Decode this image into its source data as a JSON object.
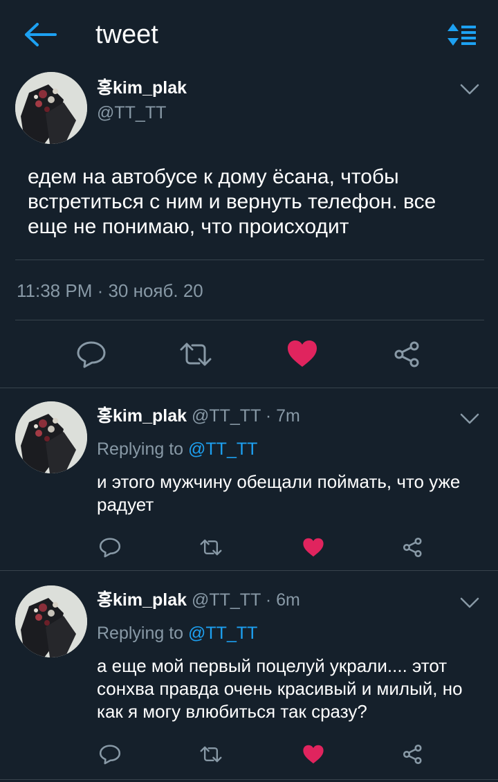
{
  "header": {
    "title": "tweet",
    "back_icon": "arrow-left-icon",
    "sort_icon": "sort-lines-icon"
  },
  "colors": {
    "background": "#15202b",
    "accent": "#1da1f2",
    "secondary_text": "#8899a6",
    "like": "#e0245e",
    "divider": "#38444d"
  },
  "main_tweet": {
    "display_name": "홍kim_plak",
    "handle": "@TT_TT",
    "text": "едем на автобусе к дому ёсана, чтобы встретиться с ним и вернуть телефон. все еще не понимаю, что происходит",
    "timestamp": "11:38 PM · 30 нояб. 20",
    "liked": true
  },
  "replies": [
    {
      "display_name": "홍kim_plak",
      "handle_time": "@TT_TT · 7m",
      "replying_prefix": "Replying to",
      "replying_mention": "@TT_TT",
      "text": "и этого мужчину обещали поймать, что уже радует",
      "liked": true
    },
    {
      "display_name": "홍kim_plak",
      "handle_time": "@TT_TT · 6m",
      "replying_prefix": "Replying to",
      "replying_mention": "@TT_TT",
      "text": "а еще мой первый поцелуй украли.... этот сонхва правда очень красивый и милый, но как я могу влюбиться так сразу?",
      "liked": true
    }
  ]
}
